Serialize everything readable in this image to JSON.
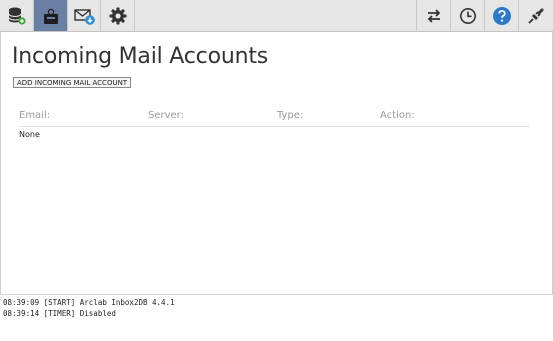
{
  "toolbar": {
    "left_buttons": [
      {
        "icon": "database-add-icon"
      },
      {
        "icon": "user-accounts-icon",
        "active": true
      },
      {
        "icon": "mail-download-icon"
      },
      {
        "icon": "gear-icon"
      }
    ],
    "right_buttons": [
      {
        "icon": "transfer-arrows-icon"
      },
      {
        "icon": "clock-icon"
      },
      {
        "icon": "help-icon"
      },
      {
        "icon": "plug-connect-icon"
      }
    ],
    "colors": {
      "active_bg": "#6a7fa4",
      "help_blue": "#2d78c8",
      "download_blue": "#2f8fd8"
    }
  },
  "page": {
    "title": "Incoming Mail Accounts",
    "add_button": "ADD INCOMING MAIL ACCOUNT"
  },
  "table": {
    "columns": [
      "Email:",
      "Server:",
      "Type:",
      "Action:"
    ],
    "empty_text": "None"
  },
  "log": {
    "lines": [
      "08:39:09 [START] Arclab Inbox2DB 4.4.1",
      "08:39:14 [TIMER] Disabled"
    ]
  }
}
